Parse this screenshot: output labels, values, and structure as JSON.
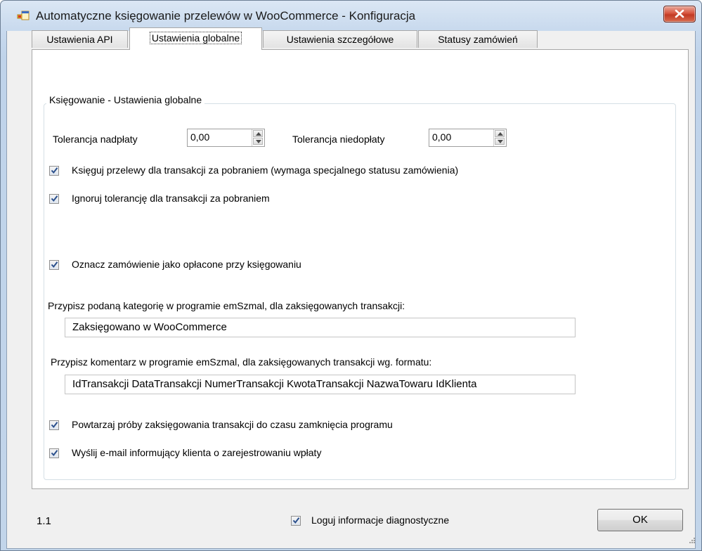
{
  "window": {
    "title": "Automatyczne księgowanie przelewów w WooCommerce - Konfiguracja",
    "icon": "app-window-icon",
    "close_icon": "close-x-icon"
  },
  "tabs": [
    {
      "label": "Ustawienia API",
      "active": false
    },
    {
      "label": "Ustawienia globalne",
      "active": true
    },
    {
      "label": "Ustawienia szczegółowe",
      "active": false
    },
    {
      "label": "Statusy zamówień",
      "active": false
    }
  ],
  "group": {
    "title": "Księgowanie - Ustawienia globalne",
    "overpayment": {
      "label": "Tolerancja nadpłaty",
      "value": "0,00"
    },
    "underpayment": {
      "label": "Tolerancja niedopłaty",
      "value": "0,00"
    },
    "checkboxes": [
      {
        "label": "Księguj przelewy dla transakcji za pobraniem (wymaga specjalnego statusu zamówienia)",
        "checked": true
      },
      {
        "label": "Ignoruj tolerancję dla transakcji za pobraniem",
        "checked": true
      },
      {
        "label": "Oznacz zamówienie jako opłacone przy księgowaniu",
        "checked": true
      }
    ],
    "category": {
      "label": "Przypisz podaną kategorię w programie emSzmal, dla zaksięgowanych transakcji:",
      "value": "Zaksięgowano w WooCommerce"
    },
    "comment": {
      "label": "Przypisz komentarz w programie emSzmal, dla zaksięgowanych transakcji wg. formatu:",
      "value": "IdTransakcji DataTransakcji NumerTransakcji KwotaTransakcji NazwaTowaru IdKlienta"
    },
    "checkboxes_bottom": [
      {
        "label": "Powtarzaj próby zaksięgowania transakcji do czasu zamknięcia programu",
        "checked": true
      },
      {
        "label": "Wyślij e-mail informujący klienta o zarejestrowaniu wpłaty",
        "checked": true
      }
    ]
  },
  "footer": {
    "version": "1.1",
    "diagnostics": {
      "label": "Loguj informacje diagnostyczne",
      "checked": true
    },
    "ok_label": "OK"
  }
}
